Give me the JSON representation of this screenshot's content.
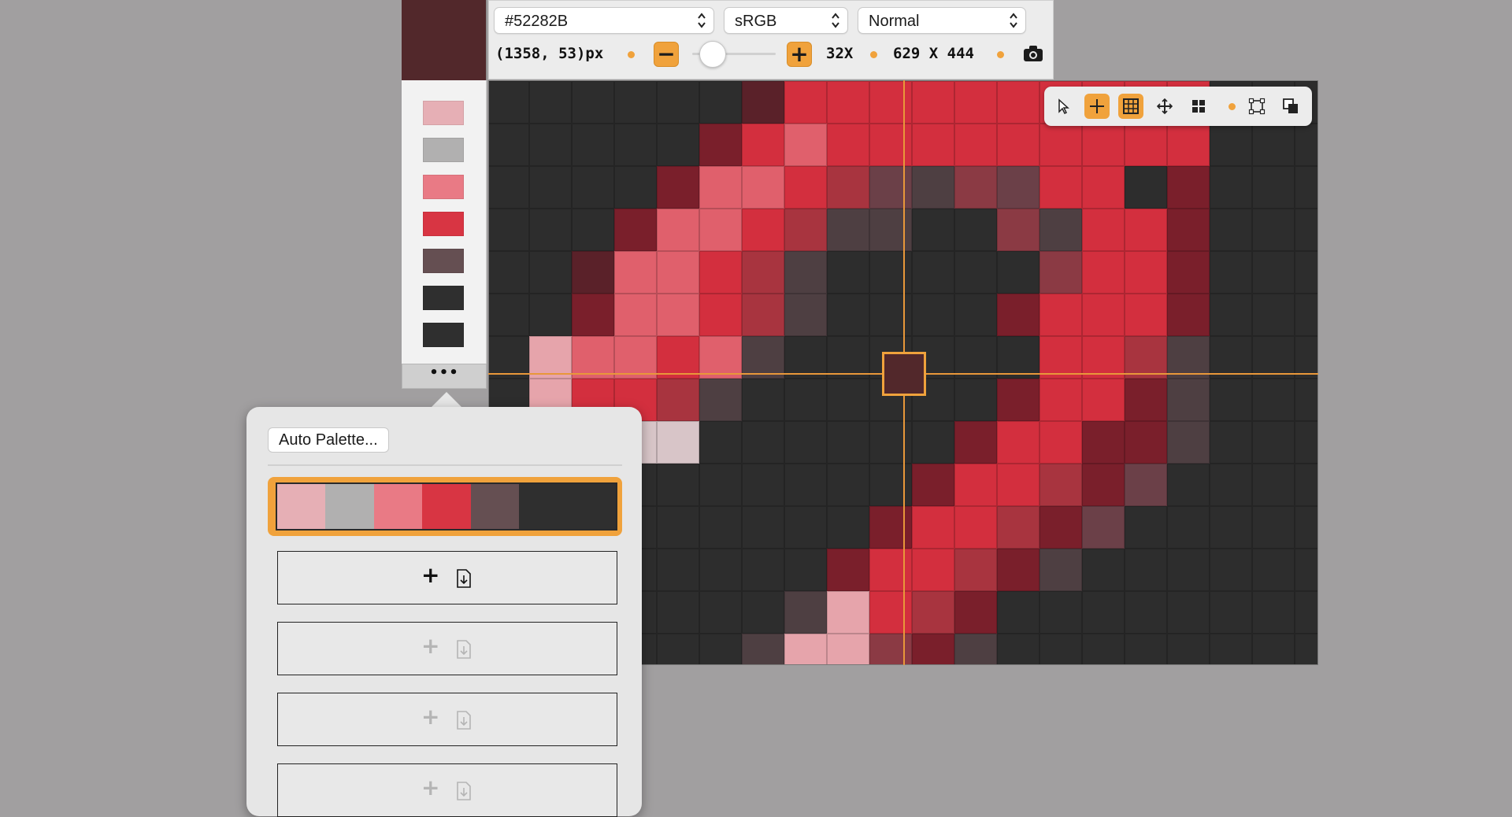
{
  "current_color": "#52282B",
  "swatches": [
    "#e6afb5",
    "#b1b0b0",
    "#e97a85",
    "#d83543",
    "#654f52",
    "#2f2f2f",
    "#2f2f2f"
  ],
  "more_button": {
    "label": "•••"
  },
  "toolbar": {
    "hex_value": "#52282B",
    "color_space": "sRGB",
    "blend_mode": "Normal",
    "coordinates": "(1358, 53)px",
    "zoom_level": "32X",
    "zoom_slider_fraction": 0.15,
    "selection_size": "629 X 444",
    "zoom_out_label": "−",
    "zoom_in_label": "+",
    "icons": [
      "chevron-updown-icon",
      "camera-icon"
    ]
  },
  "canvas": {
    "pixels": [
      "kkkkkkkkkkkkkkkkkkkkkkkkk",
      "kkkkkkkkkkkkkkkkkkkkkkkkk",
      "kkkkkkdRRRRRRRRRRkkkkkkkk",
      "kkkkkDRrRRRRRRRRRkkkkkkkk",
      "kkkkDrrRMGgmGRRkDkkkkkkkk",
      "kkkDrrRMggkkmgRRDkkkkkkkk",
      "kkdrrRMgkkkkkmRRDkkkkkkkk",
      "kkDrrRMgkkkkDRRRDkkkkkkkk",
      "kprrRrgkkkkkkRRMgkkkkkkkk",
      "kpRRMgkkkkkkDRRDgkkkkkkkk",
      "kklllkkkkkkDRRDDgkkkkkkkk",
      "kkkkkkkkkkDRRMDGkkkkkkkkk",
      "kkkkkkkkkDRRMDGkkkkkkkkkk",
      "kkkkkkkkDRRMDgkkkkkkkkkkk",
      "kkkkkkkgpRMDkkkkkkkkkkkkk",
      "kkkkkkgppmDgkkkkkkkkkkkkk",
      "kkkkkkkkkkkkkkkkkkkkkkkkk"
    ],
    "palette_key": {
      "k": "#2d2d2d",
      "R": "#d32f3e",
      "r": "#e0606c",
      "D": "#7a1f2b",
      "d": "#5a2129",
      "M": "#a8343f",
      "G": "#6b4048",
      "g": "#4e3f42",
      "m": "#8b3a44",
      "p": "#e6a4ab",
      "l": "#d8c5c8"
    }
  },
  "tools": {
    "items": [
      {
        "icon": "arrow-pointer-icon",
        "active": false
      },
      {
        "icon": "crosshair-icon",
        "active": true
      },
      {
        "icon": "grid-icon",
        "active": true
      },
      {
        "icon": "move-arrows-icon",
        "active": false
      },
      {
        "icon": "quad-grid-icon",
        "active": false
      },
      {
        "icon": "dot-separator",
        "active": false
      },
      {
        "icon": "bounding-box-icon",
        "active": false
      },
      {
        "icon": "overlap-squares-icon",
        "active": false
      }
    ]
  },
  "palette_popover": {
    "auto_palette_label": "Auto Palette...",
    "selected_palette": [
      "#e6afb5",
      "#b1b0b0",
      "#e97a85",
      "#d83543",
      "#654f52",
      "#2f2f2f",
      "#2f2f2f"
    ],
    "slots": [
      {
        "plus": "+",
        "enabled": true
      },
      {
        "plus": "+",
        "enabled": false
      },
      {
        "plus": "+",
        "enabled": false
      },
      {
        "plus": "+",
        "enabled": false
      }
    ]
  }
}
